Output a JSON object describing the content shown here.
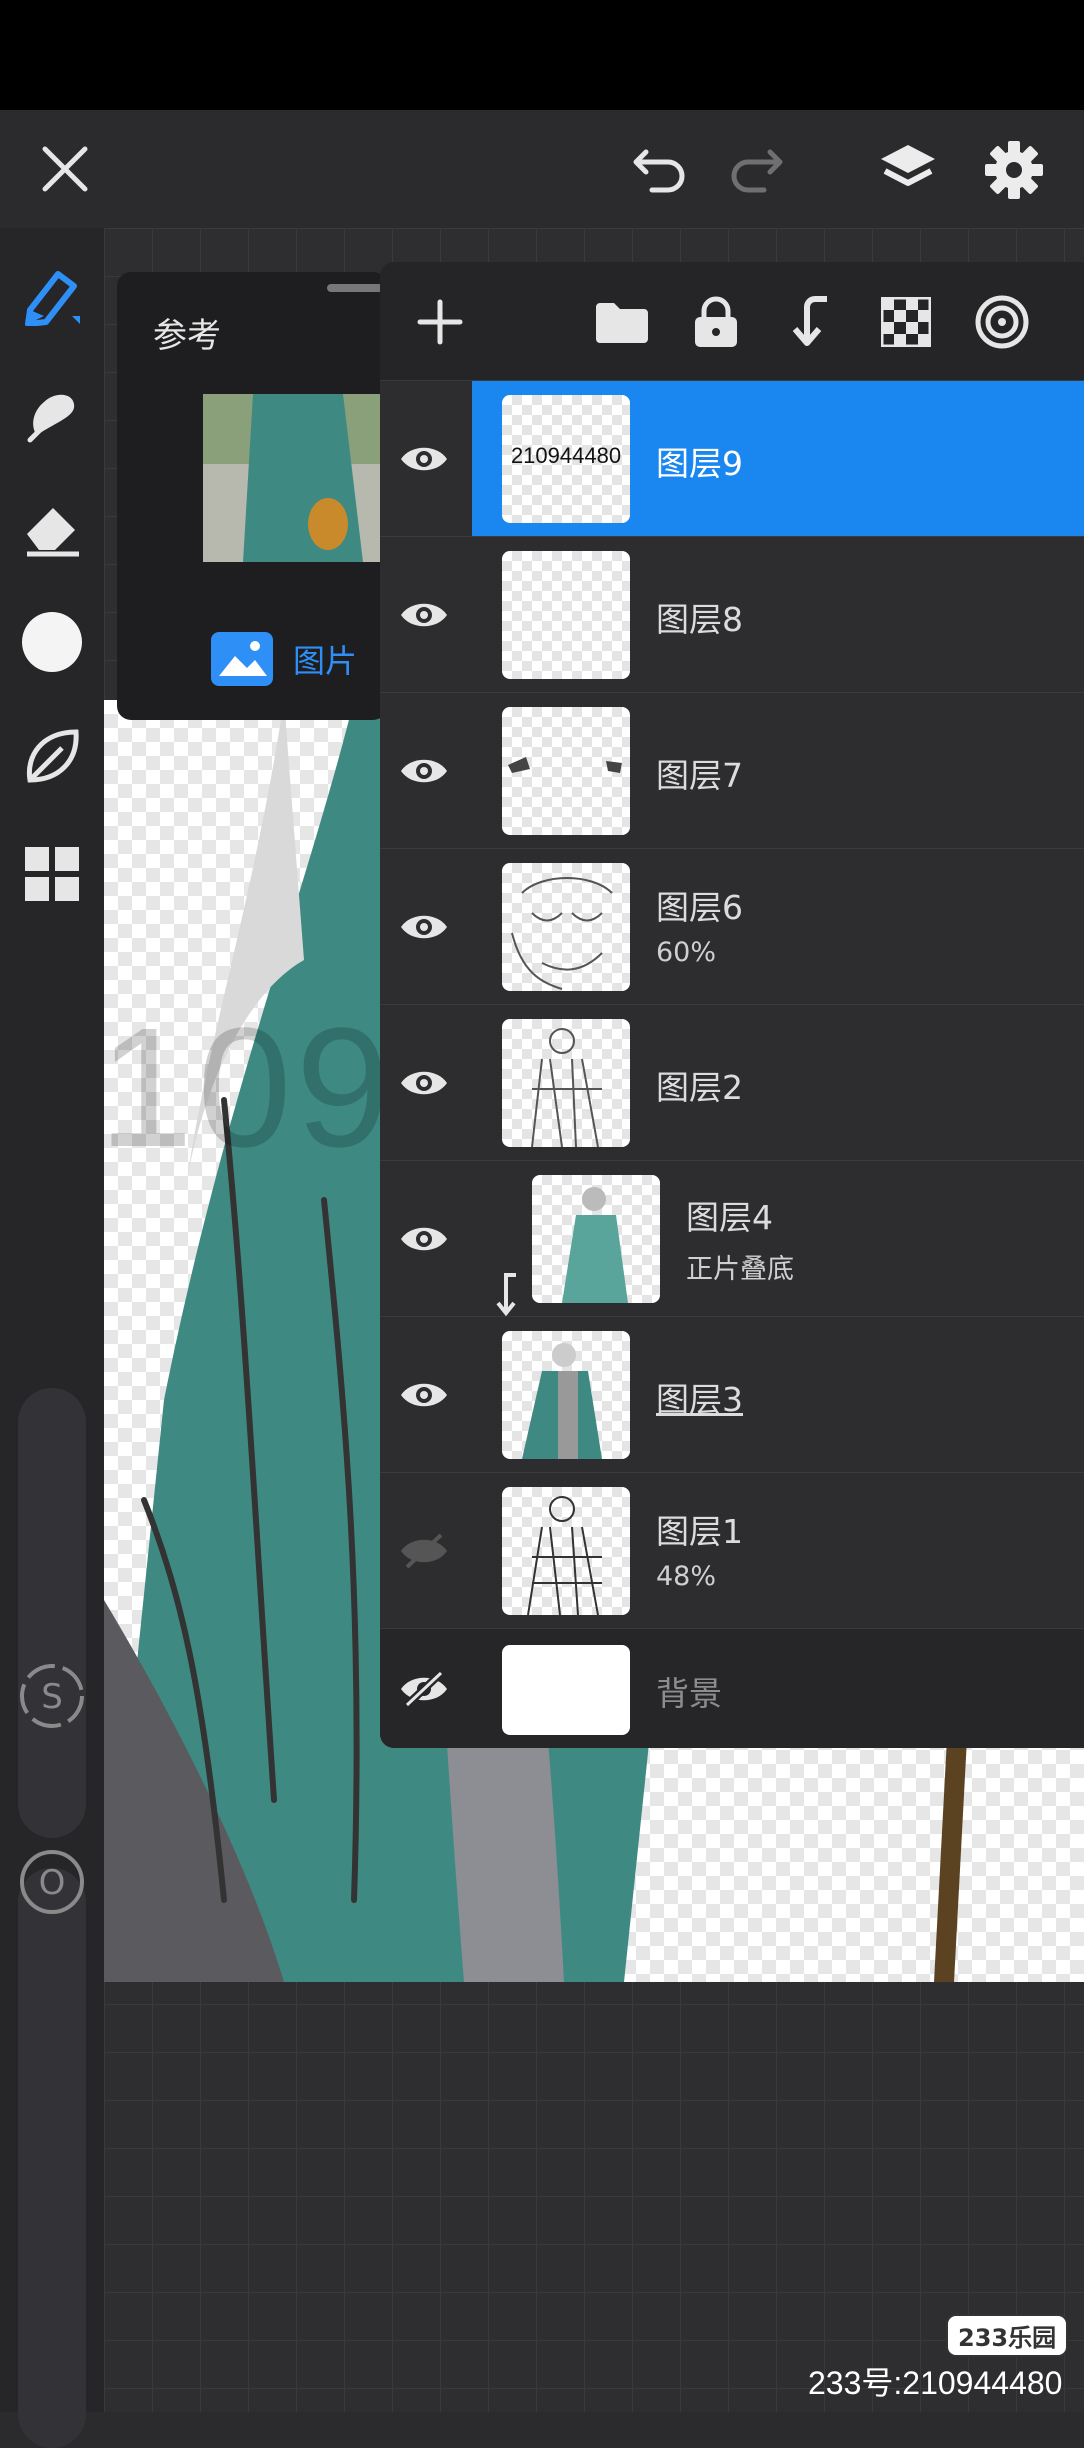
{
  "watermark_text": "210944480",
  "reference": {
    "title": "参考",
    "image_label": "图片"
  },
  "layers": [
    {
      "name": "图层9",
      "thumb_text": "210944480",
      "selected": true,
      "visible": true
    },
    {
      "name": "图层8",
      "visible": true
    },
    {
      "name": "图层7",
      "visible": true
    },
    {
      "name": "图层6",
      "sub": "60%",
      "visible": true
    },
    {
      "name": "图层2",
      "visible": true
    },
    {
      "name": "图层4",
      "sub": "正片叠底",
      "visible": true,
      "clipped": true
    },
    {
      "name": "图层3",
      "visible": true
    },
    {
      "name": "图层1",
      "sub": "48%",
      "visible": false
    },
    {
      "name": "背景",
      "visible": false
    }
  ],
  "footer": {
    "logo": "233乐园",
    "id_text": "233号:210944480"
  },
  "colors": {
    "accent": "#1a86f0",
    "brush_active": "#2e8ff6"
  },
  "icons": {
    "topbar": [
      "close-icon",
      "undo-icon",
      "redo-icon",
      "layers-icon",
      "settings-icon"
    ],
    "tools": [
      "brush-icon",
      "smudge-icon",
      "eraser-icon",
      "color-circle-icon",
      "leaf-icon",
      "grid-icon"
    ],
    "layer_tools": [
      "add-icon",
      "folder-icon",
      "lock-icon",
      "merge-down-icon",
      "transparency-icon",
      "blend-icon"
    ]
  }
}
